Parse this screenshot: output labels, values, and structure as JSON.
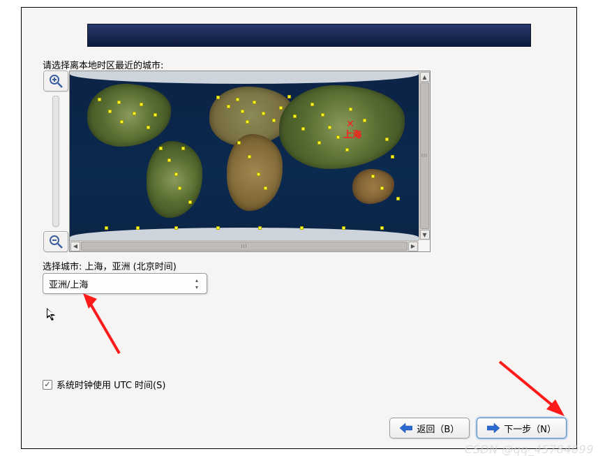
{
  "header": {
    "title": ""
  },
  "prompt": "请选择离本地时区最近的城市:",
  "map": {
    "zoom_in": "+",
    "zoom_out": "−",
    "vscroll_up": "▲",
    "vscroll_down": "▼",
    "hscroll_left": "◀",
    "hscroll_right": "▶",
    "thumb_grip": "III",
    "selected_marker_label": "上海",
    "selected_marker_x": "✕"
  },
  "selection": {
    "label_prefix": "选择城市: ",
    "label_value": "上海，亚洲 (北京时间)",
    "dropdown_value": "亚洲/上海",
    "spin_up": "▴",
    "spin_down": "▾"
  },
  "options": {
    "utc_checkbox_label": "系统时钟使用 UTC 时间(S)",
    "utc_checked_glyph": "✓"
  },
  "buttons": {
    "back": "返回（B）",
    "next": "下一步（N）"
  },
  "watermark": "CSDN @qq_45784099",
  "colors": {
    "arrow": "#ff1a1a",
    "next_icon": "#2b6bd1",
    "back_icon": "#2b6bd1",
    "magnifier": "#3c5fa2"
  }
}
